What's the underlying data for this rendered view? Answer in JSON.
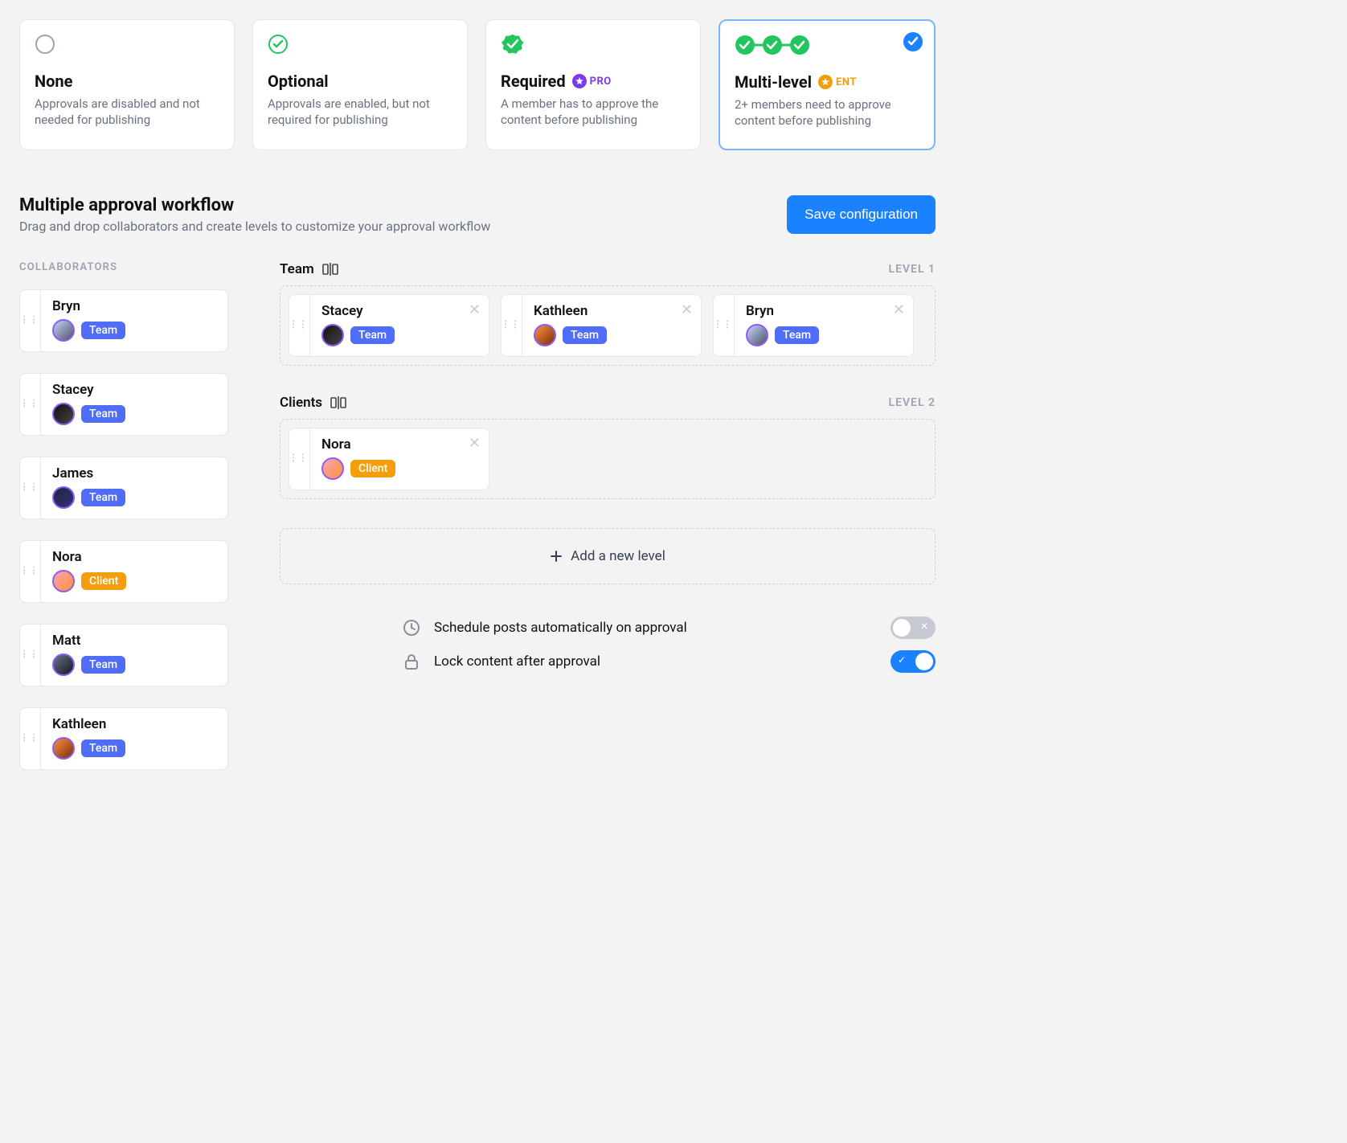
{
  "options": [
    {
      "title": "None",
      "desc": "Approvals are disabled and not needed for publishing",
      "icon": "none",
      "tier": null,
      "selected": false
    },
    {
      "title": "Optional",
      "desc": "Approvals are enabled, but not required for publishing",
      "icon": "single-outline",
      "tier": null,
      "selected": false
    },
    {
      "title": "Required",
      "desc": "A member has to approve the content before publishing",
      "icon": "single-solid",
      "tier": "PRO",
      "selected": false
    },
    {
      "title": "Multi-level",
      "desc": "2+ members need to approve content before publishing",
      "icon": "triple",
      "tier": "ENT",
      "selected": true
    }
  ],
  "section": {
    "title": "Multiple approval workflow",
    "subtitle": "Drag and drop collaborators and create levels to customize your approval workflow",
    "save_label": "Save configuration",
    "collaborators_label": "COLLABORATORS",
    "add_level_label": "Add a new level",
    "level_word": "LEVEL"
  },
  "roles": {
    "team": "Team",
    "client": "Client"
  },
  "collaborators": [
    {
      "name": "Bryn",
      "role": "team"
    },
    {
      "name": "Stacey",
      "role": "team"
    },
    {
      "name": "James",
      "role": "team"
    },
    {
      "name": "Nora",
      "role": "client"
    },
    {
      "name": "Matt",
      "role": "team"
    },
    {
      "name": "Kathleen",
      "role": "team"
    }
  ],
  "levels": [
    {
      "name": "Team",
      "idx": 1,
      "members": [
        {
          "name": "Stacey",
          "role": "team"
        },
        {
          "name": "Kathleen",
          "role": "team"
        },
        {
          "name": "Bryn",
          "role": "team"
        }
      ]
    },
    {
      "name": "Clients",
      "idx": 2,
      "members": [
        {
          "name": "Nora",
          "role": "client"
        }
      ]
    }
  ],
  "settings": {
    "auto_schedule": {
      "label": "Schedule posts automatically on approval",
      "on": false
    },
    "lock_content": {
      "label": "Lock content after approval",
      "on": true
    }
  }
}
